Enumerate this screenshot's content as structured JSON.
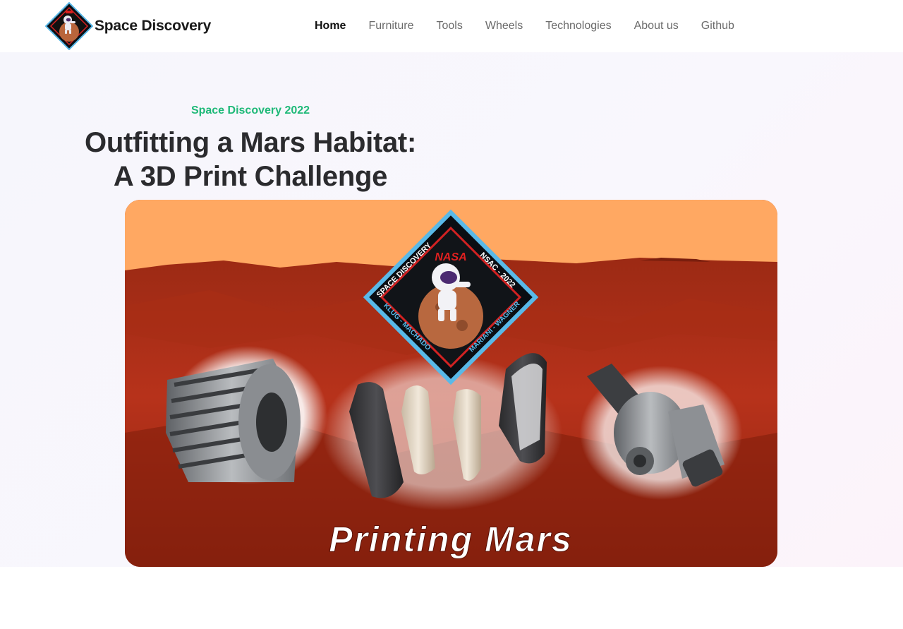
{
  "header": {
    "brand_name": "Space Discovery",
    "nav_items": [
      {
        "label": "Home",
        "active": true
      },
      {
        "label": "Furniture",
        "active": false
      },
      {
        "label": "Tools",
        "active": false
      },
      {
        "label": "Wheels",
        "active": false
      },
      {
        "label": "Technologies",
        "active": false
      },
      {
        "label": "About us",
        "active": false
      },
      {
        "label": "Github",
        "active": false
      }
    ]
  },
  "hero": {
    "eyebrow": "Space Discovery 2022",
    "title_line1": "Outfitting a Mars Habitat:",
    "title_line2": "A 3D Print Challenge",
    "banner": {
      "caption": "Printing Mars",
      "badge_top_left": "SPACE DISCOVERY",
      "badge_top_right": "NSAC - 2022",
      "badge_bottom_left": "KLUG - MACHADO",
      "badge_bottom_right": "MARIANI - WAGNER",
      "badge_logo": "NASA"
    }
  },
  "colors": {
    "accent_green": "#1fb978",
    "title_dark": "#2b2b2e",
    "nav_muted": "#6b6b6b",
    "mars_sky": "#ffa862",
    "mars_ground": "#b2301a"
  }
}
